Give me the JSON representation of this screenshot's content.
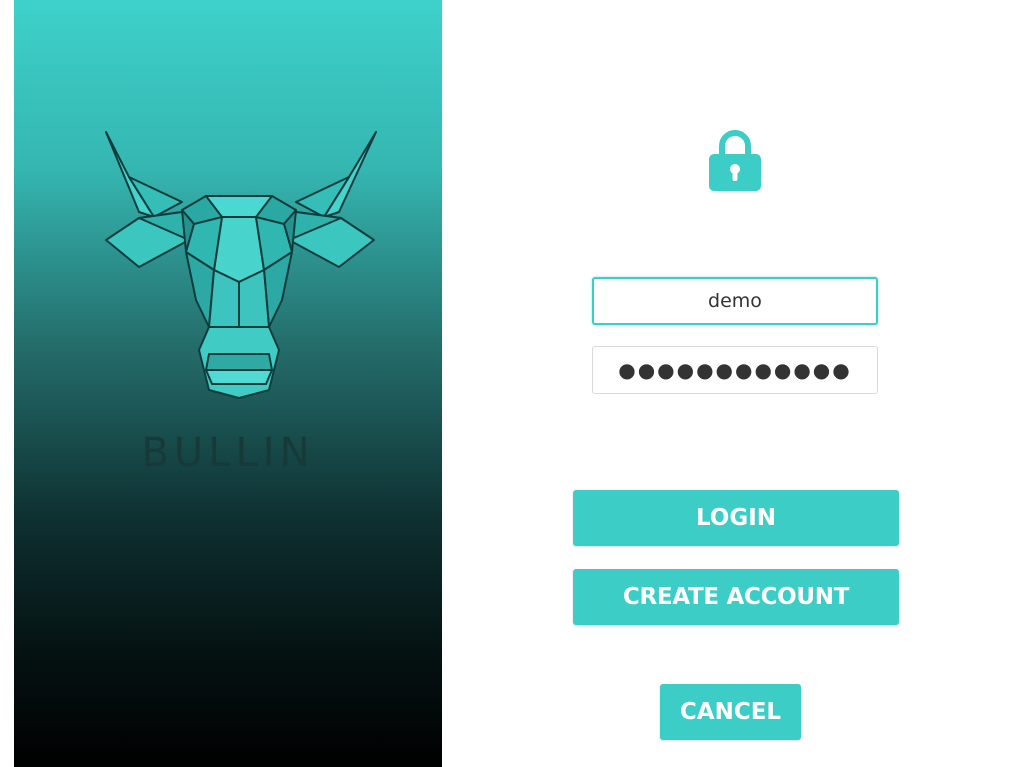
{
  "brand": {
    "name": "BULLIN",
    "logo_icon": "geometric-bull-head",
    "colors": {
      "accent": "#3ccdc7",
      "gradient_top": "#3ed1cb",
      "gradient_bottom": "#000000"
    }
  },
  "form": {
    "lock_icon": "padlock-icon",
    "username": {
      "value": "demo"
    },
    "password": {
      "value": "●●●●●●●●●●●●"
    },
    "buttons": {
      "login_label": "LOGIN",
      "create_account_label": "CREATE ACCOUNT",
      "cancel_label": "CANCEL"
    }
  }
}
